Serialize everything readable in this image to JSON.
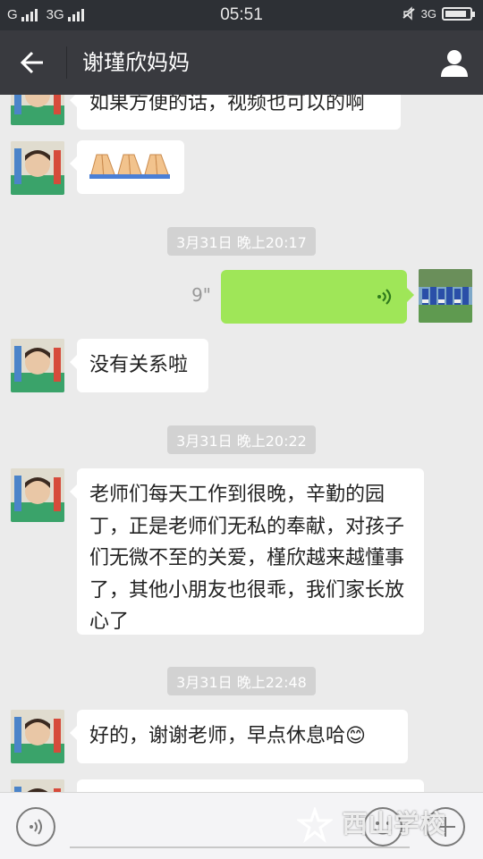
{
  "status_bar": {
    "carrier_left": "G",
    "network_label": "3G",
    "time": "05:51",
    "network_right": "3G",
    "battery_level": 0.9
  },
  "header": {
    "title": "谢瑾欣妈妈"
  },
  "messages": [
    {
      "type": "text",
      "from": "other",
      "text": "如果方便的话，视频也可以的啊"
    },
    {
      "type": "emoji",
      "from": "other",
      "text": "🙏🙏🙏"
    },
    {
      "type": "time",
      "text": "3月31日 晚上20:17"
    },
    {
      "type": "voice",
      "from": "me",
      "duration": "9\""
    },
    {
      "type": "text",
      "from": "other",
      "text": "没有关系啦"
    },
    {
      "type": "time",
      "text": "3月31日 晚上20:22"
    },
    {
      "type": "text",
      "from": "other",
      "text": "老师们每天工作到很晚，辛勤的园丁，正是老师们无私的奉献，对孩子们无微不至的关爱，槿欣越来越懂事了，其他小朋友也很乖，我们家长放心了"
    },
    {
      "type": "time",
      "text": "3月31日 晚上22:48"
    },
    {
      "type": "text",
      "from": "other",
      "text": "好的，谢谢老师，早点休息哈😊"
    }
  ],
  "watermark": "西山学校",
  "icons": {
    "back": "back-arrow-icon",
    "profile": "person-icon",
    "voice_toggle": "voice-icon",
    "emoji": "smiley-icon",
    "more": "plus-icon"
  },
  "colors": {
    "title_bar": "#393a3f",
    "my_bubble": "#9fe658",
    "chat_bg": "#ebebeb"
  }
}
